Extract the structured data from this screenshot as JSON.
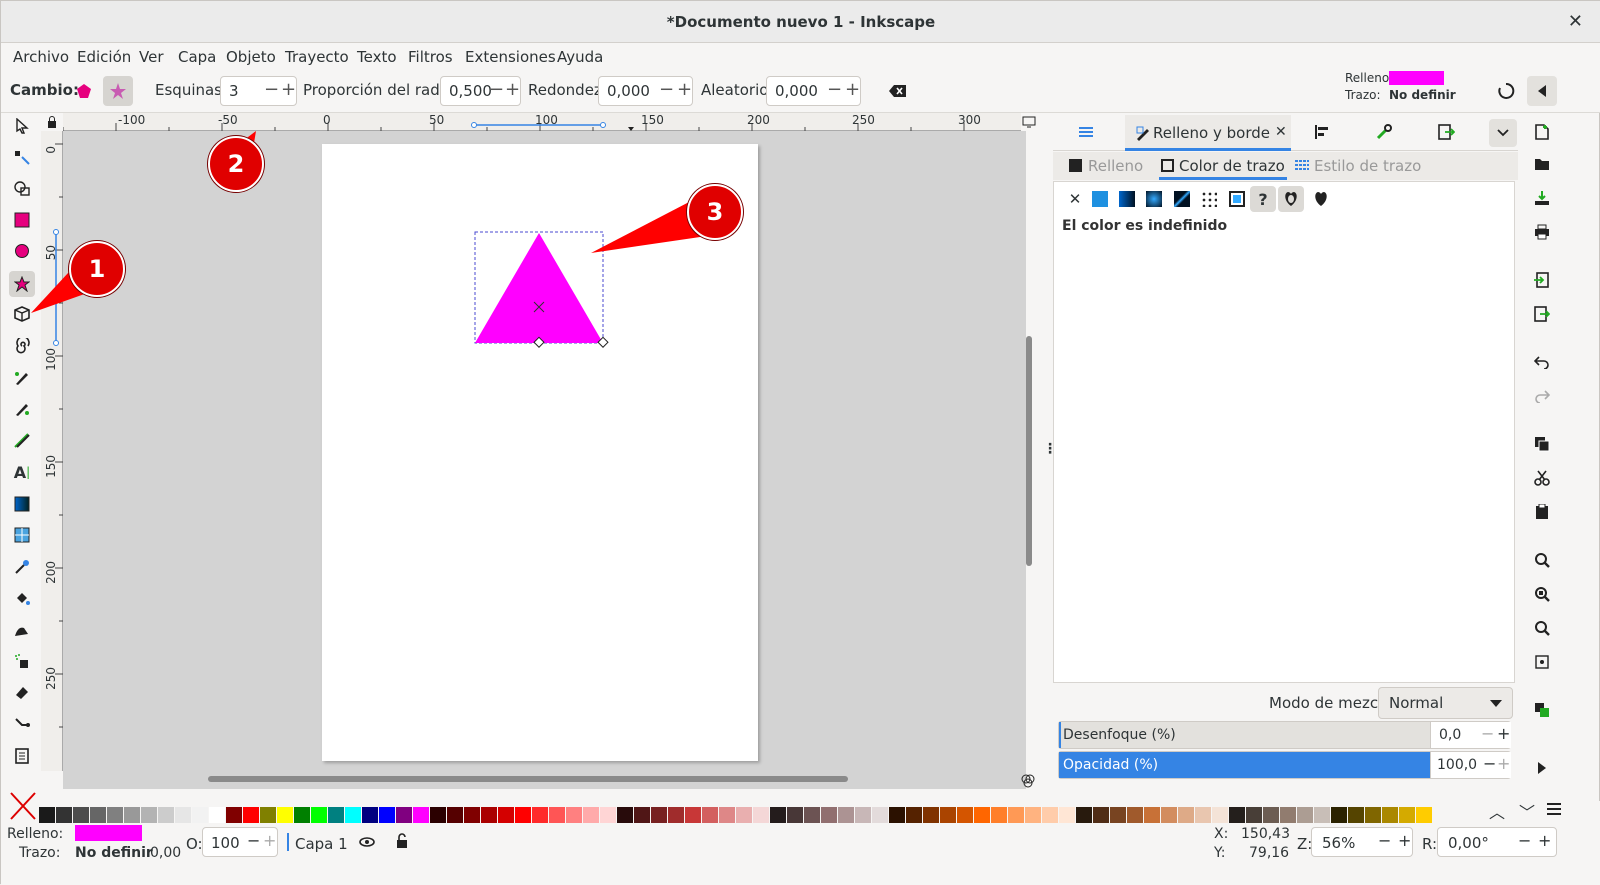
{
  "window": {
    "title": "*Documento nuevo 1 - Inkscape",
    "close_glyph": "✕"
  },
  "menu": [
    "Archivo",
    "Edición",
    "Ver",
    "Capa",
    "Objeto",
    "Trayecto",
    "Texto",
    "Filtros",
    "Extensiones",
    "Ayuda"
  ],
  "tool_controls": {
    "change_label": "Cambio:",
    "corners_label": "Esquinas:",
    "corners_value": "3",
    "ratio_label": "Proporción del radio:",
    "ratio_value": "0,500",
    "rounded_label": "Redondez:",
    "rounded_value": "0,000",
    "random_label": "Aleatorio:",
    "random_value": "0,000",
    "fill_label": "Relleno:",
    "stroke_label": "Trazo:",
    "stroke_value": "No definir",
    "fill_color": "#ff00ff"
  },
  "ruler": {
    "h_ticks": [
      "-100",
      "-50",
      "0",
      "50",
      "100",
      "150",
      "200",
      "250",
      "300"
    ],
    "v_ticks": [
      "0",
      "50",
      "100",
      "150",
      "200",
      "250"
    ]
  },
  "panel": {
    "tab_title": "Relleno y borde",
    "subtabs": [
      "Relleno",
      "Color de trazo",
      "Estilo de trazo"
    ],
    "status_text": "El color es indefinido",
    "blend_label": "Modo de mezcla:",
    "blend_value": "Normal",
    "blur_label": "Desenfoque (%)",
    "blur_value": "0,0",
    "opacity_label": "Opacidad (%)",
    "opacity_value": "100,0"
  },
  "status": {
    "fill_label": "Relleno:",
    "stroke_label": "Trazo:",
    "stroke_value": "No definir",
    "stroke_width": "0,00",
    "opacity_label": "O:",
    "opacity_value": "100",
    "layer": "Capa 1",
    "x_label": "X:",
    "x_value": "150,43",
    "y_label": "Y:",
    "y_value": "79,16",
    "zoom_label": "Z:",
    "zoom_value": "56%",
    "rot_label": "R:",
    "rot_value": "0,00°"
  },
  "callouts": [
    "1",
    "2",
    "3"
  ],
  "colors": {
    "accent": "#3584e4",
    "shape_fill": "#ff00ff",
    "callout": "#e00000"
  }
}
